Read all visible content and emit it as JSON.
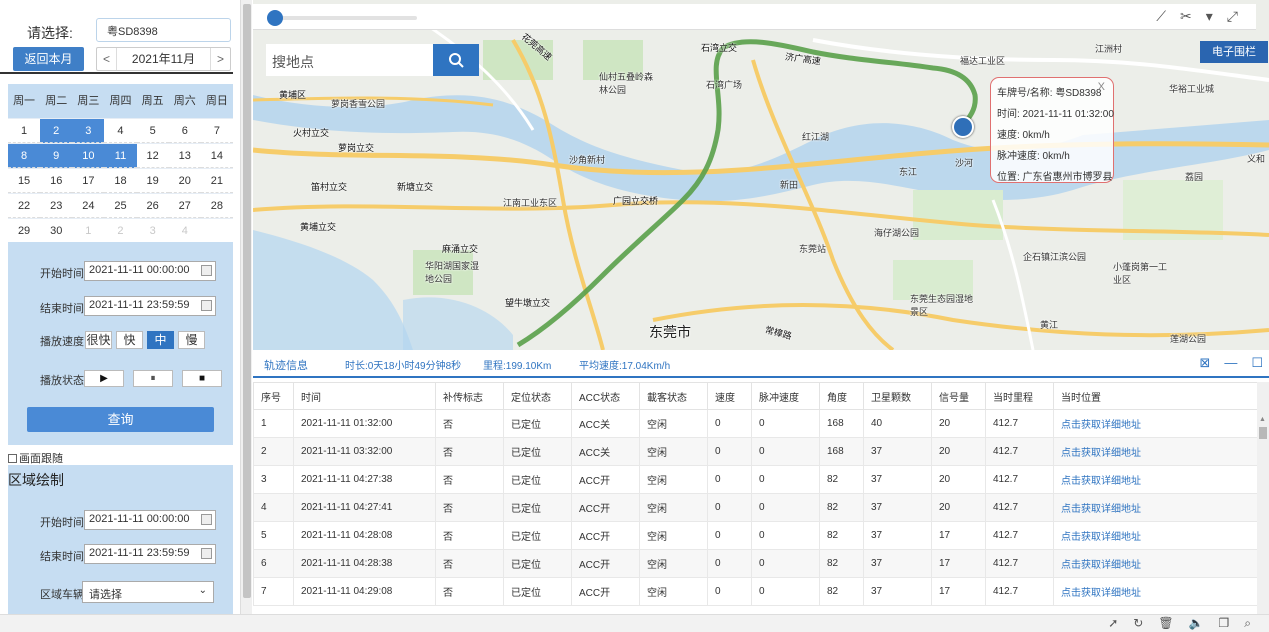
{
  "left": {
    "select_label": "请选择:",
    "vehicle_value": "粤SD8398",
    "back_month": "返回本月",
    "month_prev": "<",
    "month_current": "2021年11月",
    "month_next": ">",
    "weekdays": [
      "周一",
      "周二",
      "周三",
      "周四",
      "周五",
      "周六",
      "周日"
    ],
    "calendar_rows": [
      [
        {
          "d": "1",
          "s": ""
        },
        {
          "d": "2",
          "s": "sel"
        },
        {
          "d": "3",
          "s": "sel"
        },
        {
          "d": "4",
          "s": ""
        },
        {
          "d": "5",
          "s": ""
        },
        {
          "d": "6",
          "s": ""
        },
        {
          "d": "7",
          "s": ""
        }
      ],
      [
        {
          "d": "8",
          "s": "sel"
        },
        {
          "d": "9",
          "s": "sel"
        },
        {
          "d": "10",
          "s": "sel"
        },
        {
          "d": "11",
          "s": "sel"
        },
        {
          "d": "12",
          "s": ""
        },
        {
          "d": "13",
          "s": ""
        },
        {
          "d": "14",
          "s": ""
        }
      ],
      [
        {
          "d": "15",
          "s": ""
        },
        {
          "d": "16",
          "s": ""
        },
        {
          "d": "17",
          "s": ""
        },
        {
          "d": "18",
          "s": ""
        },
        {
          "d": "19",
          "s": ""
        },
        {
          "d": "20",
          "s": ""
        },
        {
          "d": "21",
          "s": ""
        }
      ],
      [
        {
          "d": "22",
          "s": ""
        },
        {
          "d": "23",
          "s": ""
        },
        {
          "d": "24",
          "s": ""
        },
        {
          "d": "25",
          "s": ""
        },
        {
          "d": "26",
          "s": ""
        },
        {
          "d": "27",
          "s": ""
        },
        {
          "d": "28",
          "s": ""
        }
      ],
      [
        {
          "d": "29",
          "s": ""
        },
        {
          "d": "30",
          "s": ""
        },
        {
          "d": "1",
          "s": "dim"
        },
        {
          "d": "2",
          "s": "dim"
        },
        {
          "d": "3",
          "s": "dim"
        },
        {
          "d": "4",
          "s": "dim"
        },
        {
          "d": "",
          "s": ""
        }
      ]
    ],
    "playback": {
      "start_label": "开始时间",
      "start_value": "2021-11-11 00:00:00",
      "end_label": "结束时间",
      "end_value": "2021-11-11 23:59:59",
      "speed_label": "播放速度",
      "speeds": [
        "很快",
        "快",
        "中",
        "慢"
      ],
      "active_speed": "中",
      "state_label": "播放状态",
      "state_buttons": [
        "▶",
        "⏸",
        "■"
      ],
      "query_label": "查询"
    },
    "follow_label": "画面跟随",
    "area": {
      "title": "区域绘制",
      "start_label": "开始时间",
      "start_value": "2021-11-11 00:00:00",
      "end_label": "结束时间",
      "end_value": "2021-11-11 23:59:59",
      "vehicle_label": "区域车辆",
      "vehicle_placeholder": "请选择"
    }
  },
  "map": {
    "search_placeholder": "搜地点",
    "fence_button": "电子围栏",
    "info": {
      "plate": "车牌号/名称: 粤SD8398",
      "close": "X",
      "time": "时间: 2021-11-11 01:32:00",
      "speed": "速度: 0km/h",
      "pulse_speed": "脉冲速度: 0km/h",
      "location": "位置: 广东省惠州市博罗县"
    },
    "labels": {
      "huangpu": "黄埔区",
      "xiangshan": "萝岗香雪公园",
      "huocun": "火村立交",
      "luogang": "萝岗立交",
      "dicun": "笛村立交",
      "xinjing": "新塘立交",
      "huangpulj": "黄埔立交",
      "matong": "麻涌立交",
      "huayang": "华阳湖国家湿地公园",
      "wangniu": "望牛墩立交",
      "dongguan": "东莞市",
      "jiangnan": "江南工业东区",
      "guangyuan": "广园立交桥",
      "shiwan": "石湾广场",
      "shiwanlj": "石湾立交",
      "xianci": "仙村五叠岭森林公园",
      "huiguan": "花莞高速",
      "jiguang": "济广高速",
      "fuda": "福达工业区",
      "huayu": "华裕工业城",
      "jiangzhou": "江洲村",
      "dongjiang": "东江",
      "haizi": "海仔湖公园",
      "qiwei": "企石镇江滨公园",
      "shengtai": "东莞生态园湿地景区",
      "huangjiang": "黄江",
      "liancheng": "莲湖公园",
      "shitan": "沙河",
      "changping": "常樟路",
      "yihe": "义和",
      "xiaopeng": "小蓬岗第一工业区",
      "jiaoxin": "东莞站",
      "jiaokou": "荔园",
      "hongjiang": "红江湖",
      "shiban": "沙角新村",
      "jiayuan": "新田"
    }
  },
  "track": {
    "tab": "轨迹信息",
    "duration": "时长:0天18小时49分钟8秒",
    "mileage": "里程:199.10Km",
    "avg_speed": "平均速度:17.04Km/h",
    "columns": [
      "序号",
      "时间",
      "补传标志",
      "定位状态",
      "ACC状态",
      "載客状态",
      "速度",
      "脉冲速度",
      "角度",
      "卫星颗数",
      "信号量",
      "当时里程",
      "当时位置"
    ],
    "rows": [
      [
        "1",
        "2021-11-11 01:32:00",
        "否",
        "已定位",
        "ACC关",
        "空闲",
        "0",
        "0",
        "168",
        "40",
        "20",
        "412.7",
        "点击获取详细地址"
      ],
      [
        "2",
        "2021-11-11 03:32:00",
        "否",
        "已定位",
        "ACC关",
        "空闲",
        "0",
        "0",
        "168",
        "37",
        "20",
        "412.7",
        "点击获取详细地址"
      ],
      [
        "3",
        "2021-11-11 04:27:38",
        "否",
        "已定位",
        "ACC开",
        "空闲",
        "0",
        "0",
        "82",
        "37",
        "20",
        "412.7",
        "点击获取详细地址"
      ],
      [
        "4",
        "2021-11-11 04:27:41",
        "否",
        "已定位",
        "ACC开",
        "空闲",
        "0",
        "0",
        "82",
        "37",
        "20",
        "412.7",
        "点击获取详细地址"
      ],
      [
        "5",
        "2021-11-11 04:28:08",
        "否",
        "已定位",
        "ACC开",
        "空闲",
        "0",
        "0",
        "82",
        "37",
        "17",
        "412.7",
        "点击获取详细地址"
      ],
      [
        "6",
        "2021-11-11 04:28:38",
        "否",
        "已定位",
        "ACC开",
        "空闲",
        "0",
        "0",
        "82",
        "37",
        "17",
        "412.7",
        "点击获取详细地址"
      ],
      [
        "7",
        "2021-11-11 04:29:08",
        "否",
        "已定位",
        "ACC开",
        "空闲",
        "0",
        "0",
        "82",
        "37",
        "17",
        "412.7",
        "点击获取详细地址"
      ]
    ]
  },
  "colors": {
    "accent": "#2f74c1",
    "panel": "#c6ddf2",
    "route": "#5aa04a"
  }
}
